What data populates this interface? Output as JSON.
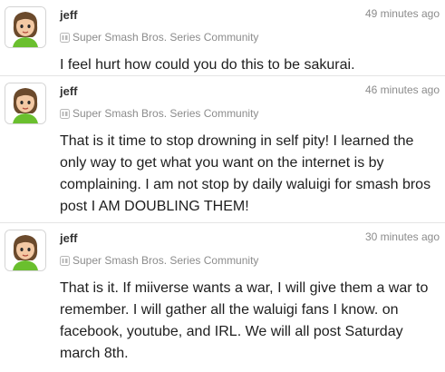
{
  "posts": [
    {
      "username": "jeff",
      "timestamp": "49 minutes ago",
      "community": "Super Smash Bros. Series Community",
      "community_icon": "wii-u-icon",
      "body": "I feel hurt how could you do this to be sakurai."
    },
    {
      "username": "jeff",
      "timestamp": "46 minutes ago",
      "community": "Super Smash Bros. Series Community",
      "community_icon": "wii-u-icon",
      "body": "That is it time to stop drowning in self pity! I learned the only way to get what you want on the internet is by complaining. I am not stop by daily waluigi for smash bros post I AM DOUBLING THEM!"
    },
    {
      "username": "jeff",
      "timestamp": "30 minutes ago",
      "community": "Super Smash Bros. Series Community",
      "community_icon": "wii-u-icon",
      "body": "That is it. If miiverse wants a war, I will give them a war to remember. I will gather all the waluigi fans I know. on facebook, youtube, and IRL. We will all post Saturday march 8th."
    }
  ],
  "colors": {
    "username": "#333333",
    "meta": "#8c8c8c",
    "body": "#1e1e1e",
    "divider": "#e4e4e4",
    "mii_shirt": "#6abf2e",
    "mii_hair": "#6b4a2c",
    "mii_skin": "#f3c9a4"
  }
}
